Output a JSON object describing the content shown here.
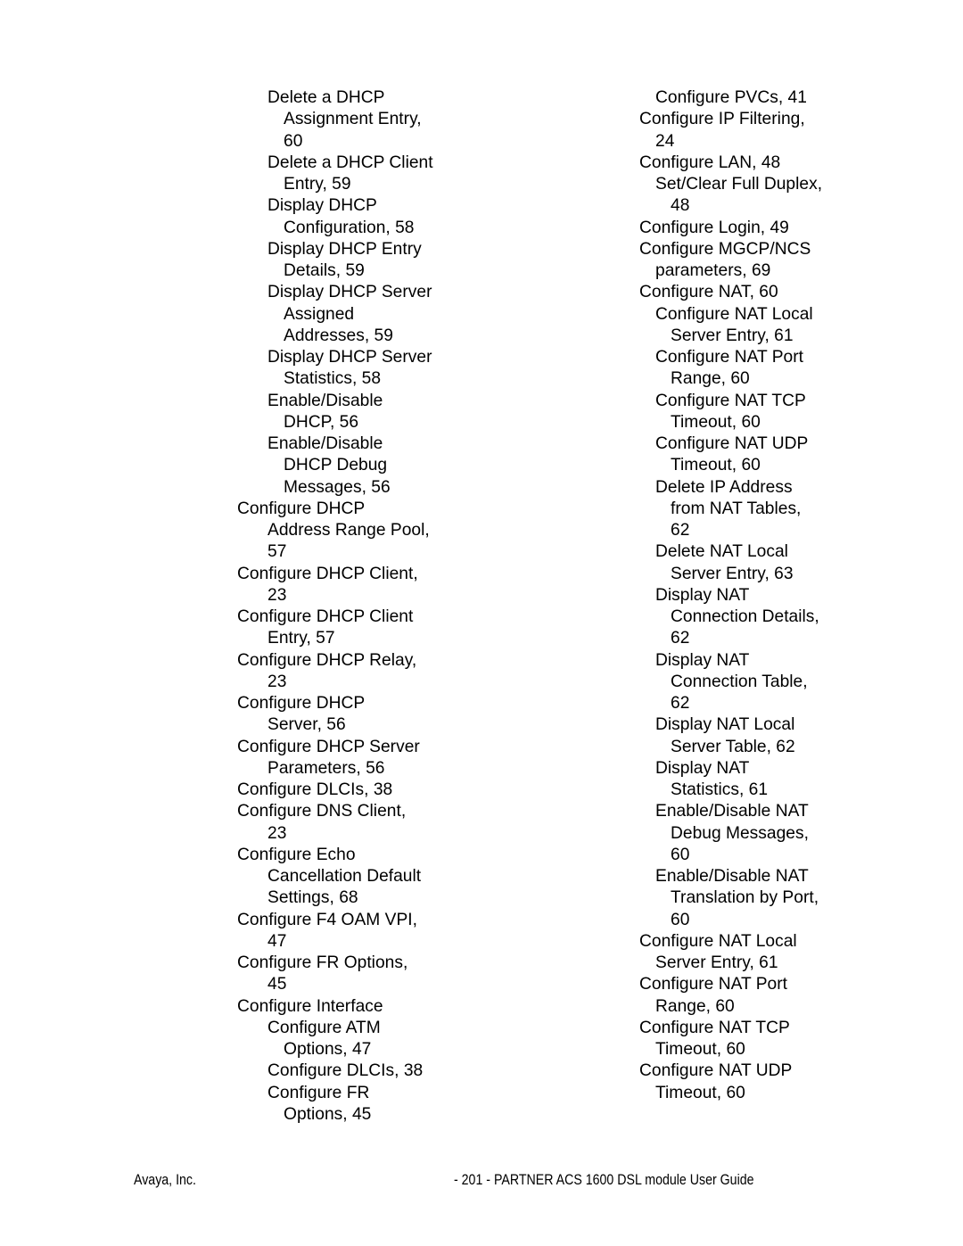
{
  "document": {
    "type": "index",
    "page_number": "201",
    "columns": 2
  },
  "index": {
    "left_column": [
      {
        "text": "Delete a DHCP",
        "level": 0
      },
      {
        "text": "Assignment Entry,",
        "level": 1
      },
      {
        "text": "60",
        "level": 1
      },
      {
        "text": "Delete a DHCP Client",
        "level": 0
      },
      {
        "text": "Entry, 59",
        "level": 1
      },
      {
        "text": "Display DHCP",
        "level": 0
      },
      {
        "text": "Configuration, 58",
        "level": 1
      },
      {
        "text": "Display DHCP Entry",
        "level": 0
      },
      {
        "text": "Details, 59",
        "level": 1
      },
      {
        "text": "Display DHCP Server",
        "level": 0
      },
      {
        "text": "Assigned",
        "level": 1
      },
      {
        "text": "Addresses, 59",
        "level": 1
      },
      {
        "text": "Display DHCP Server",
        "level": 0
      },
      {
        "text": "Statistics, 58",
        "level": 1
      },
      {
        "text": "Enable/Disable",
        "level": 0
      },
      {
        "text": "DHCP, 56",
        "level": 1
      },
      {
        "text": "Enable/Disable",
        "level": 0
      },
      {
        "text": "DHCP Debug",
        "level": 1
      },
      {
        "text": "Messages, 56",
        "level": 1
      },
      {
        "text": "Configure DHCP",
        "level": -1
      },
      {
        "text": "Address Range Pool,",
        "level": 0
      },
      {
        "text": "57",
        "level": 0
      },
      {
        "text": "Configure DHCP Client,",
        "level": -1
      },
      {
        "text": "23",
        "level": 0
      },
      {
        "text": "Configure DHCP Client",
        "level": -1
      },
      {
        "text": "Entry, 57",
        "level": 0
      },
      {
        "text": "Configure DHCP Relay,",
        "level": -1
      },
      {
        "text": "23",
        "level": 0
      },
      {
        "text": "Configure DHCP",
        "level": -1
      },
      {
        "text": "Server, 56",
        "level": 0
      },
      {
        "text": "Configure DHCP Server",
        "level": -1
      },
      {
        "text": "Parameters, 56",
        "level": 0
      },
      {
        "text": "Configure DLCIs, 38",
        "level": -1
      },
      {
        "text": "Configure DNS Client,",
        "level": -1
      },
      {
        "text": "23",
        "level": 0
      },
      {
        "text": "Configure Echo",
        "level": -1
      },
      {
        "text": "Cancellation Default",
        "level": 0
      },
      {
        "text": "Settings, 68",
        "level": 0
      },
      {
        "text": "Configure F4 OAM VPI,",
        "level": -1
      },
      {
        "text": "47",
        "level": 0
      },
      {
        "text": "Configure FR Options,",
        "level": -1
      },
      {
        "text": "45",
        "level": 0
      },
      {
        "text": "Configure Interface",
        "level": -1
      },
      {
        "text": "Configure ATM",
        "level": 0
      },
      {
        "text": "Options, 47",
        "level": 1
      },
      {
        "text": "Configure DLCIs, 38",
        "level": 0
      },
      {
        "text": "Configure FR",
        "level": 0
      },
      {
        "text": "Options, 45",
        "level": 1
      }
    ],
    "right_column": [
      {
        "text": "Configure PVCs, 41",
        "level": 1
      },
      {
        "text": "Configure IP Filtering,",
        "level": 0
      },
      {
        "text": "24",
        "level": 1
      },
      {
        "text": "Configure LAN, 48",
        "level": 0
      },
      {
        "text": "Set/Clear Full Duplex,",
        "level": 1
      },
      {
        "text": "48",
        "level": 2
      },
      {
        "text": "Configure Login, 49",
        "level": 0
      },
      {
        "text": "Configure MGCP/NCS",
        "level": 0
      },
      {
        "text": "parameters, 69",
        "level": 1
      },
      {
        "text": "Configure NAT, 60",
        "level": 0
      },
      {
        "text": "Configure NAT Local",
        "level": 1
      },
      {
        "text": "Server Entry, 61",
        "level": 2
      },
      {
        "text": "Configure NAT Port",
        "level": 1
      },
      {
        "text": "Range, 60",
        "level": 2
      },
      {
        "text": "Configure NAT TCP",
        "level": 1
      },
      {
        "text": "Timeout, 60",
        "level": 2
      },
      {
        "text": "Configure NAT UDP",
        "level": 1
      },
      {
        "text": "Timeout, 60",
        "level": 2
      },
      {
        "text": "Delete IP Address",
        "level": 1
      },
      {
        "text": "from NAT Tables,",
        "level": 2
      },
      {
        "text": "62",
        "level": 2
      },
      {
        "text": "Delete NAT Local",
        "level": 1
      },
      {
        "text": "Server Entry, 63",
        "level": 2
      },
      {
        "text": "Display NAT",
        "level": 1
      },
      {
        "text": "Connection Details,",
        "level": 2
      },
      {
        "text": "62",
        "level": 2
      },
      {
        "text": "Display NAT",
        "level": 1
      },
      {
        "text": "Connection Table,",
        "level": 2
      },
      {
        "text": "62",
        "level": 2
      },
      {
        "text": "Display NAT Local",
        "level": 1
      },
      {
        "text": "Server Table, 62",
        "level": 2
      },
      {
        "text": "Display NAT",
        "level": 1
      },
      {
        "text": "Statistics, 61",
        "level": 2
      },
      {
        "text": "Enable/Disable NAT",
        "level": 1
      },
      {
        "text": "Debug Messages,",
        "level": 2
      },
      {
        "text": "60",
        "level": 2
      },
      {
        "text": "Enable/Disable NAT",
        "level": 1
      },
      {
        "text": "Translation by Port,",
        "level": 2
      },
      {
        "text": "60",
        "level": 2
      },
      {
        "text": "Configure NAT Local",
        "level": 0
      },
      {
        "text": "Server Entry, 61",
        "level": 1
      },
      {
        "text": "Configure NAT Port",
        "level": 0
      },
      {
        "text": "Range, 60",
        "level": 1
      },
      {
        "text": "Configure NAT TCP",
        "level": 0
      },
      {
        "text": "Timeout, 60",
        "level": 1
      },
      {
        "text": "Configure NAT UDP",
        "level": 0
      },
      {
        "text": "Timeout, 60",
        "level": 1
      }
    ]
  },
  "footer": {
    "left": "Avaya, Inc.",
    "right": "- 201 - PARTNER ACS 1600 DSL module User Guide"
  }
}
